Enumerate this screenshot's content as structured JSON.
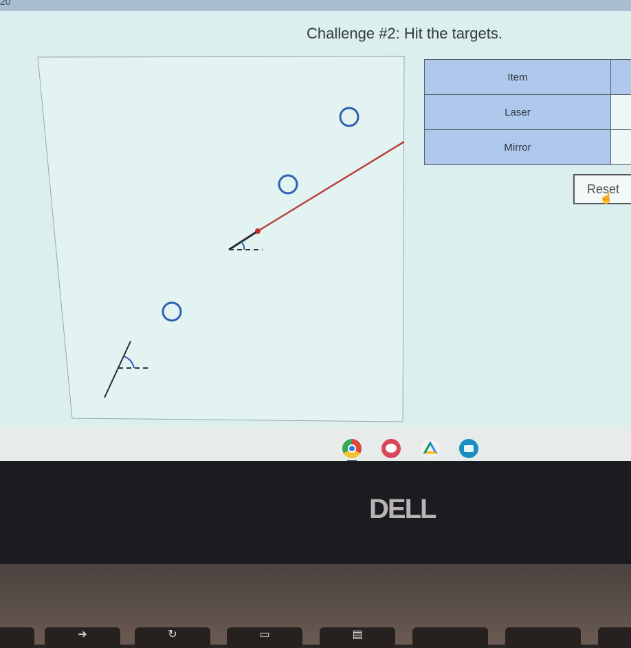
{
  "status_bar": {
    "partial_text": "20"
  },
  "app": {
    "title": "Challenge #2: Hit the targets.",
    "reset_label": "Reset"
  },
  "simulation": {
    "targets": [
      {
        "name": "target-1",
        "shape": "circle",
        "color": "#2e60b0"
      },
      {
        "name": "target-2",
        "shape": "circle",
        "color": "#2e60b0"
      },
      {
        "name": "target-3",
        "shape": "circle",
        "color": "#2e60b0"
      }
    ],
    "laser": {
      "name": "laser",
      "beam_color": "#b84040",
      "angle_indicator_color": "#2e60b0"
    },
    "mirror": {
      "name": "mirror",
      "color": "#333333",
      "angle_indicator_color": "#2e60b0"
    }
  },
  "table": {
    "header": {
      "item": "Item",
      "value": ""
    },
    "rows": [
      {
        "item": "Laser",
        "value": ""
      },
      {
        "item": "Mirror",
        "value": ""
      }
    ]
  },
  "shelf": {
    "apps": [
      {
        "name": "chrome-icon",
        "label": "Chrome"
      },
      {
        "name": "paint-icon",
        "label": "Paint"
      },
      {
        "name": "drive-icon",
        "label": "Drive"
      },
      {
        "name": "classroom-icon",
        "label": "App"
      }
    ]
  },
  "device": {
    "brand": "DELL"
  }
}
